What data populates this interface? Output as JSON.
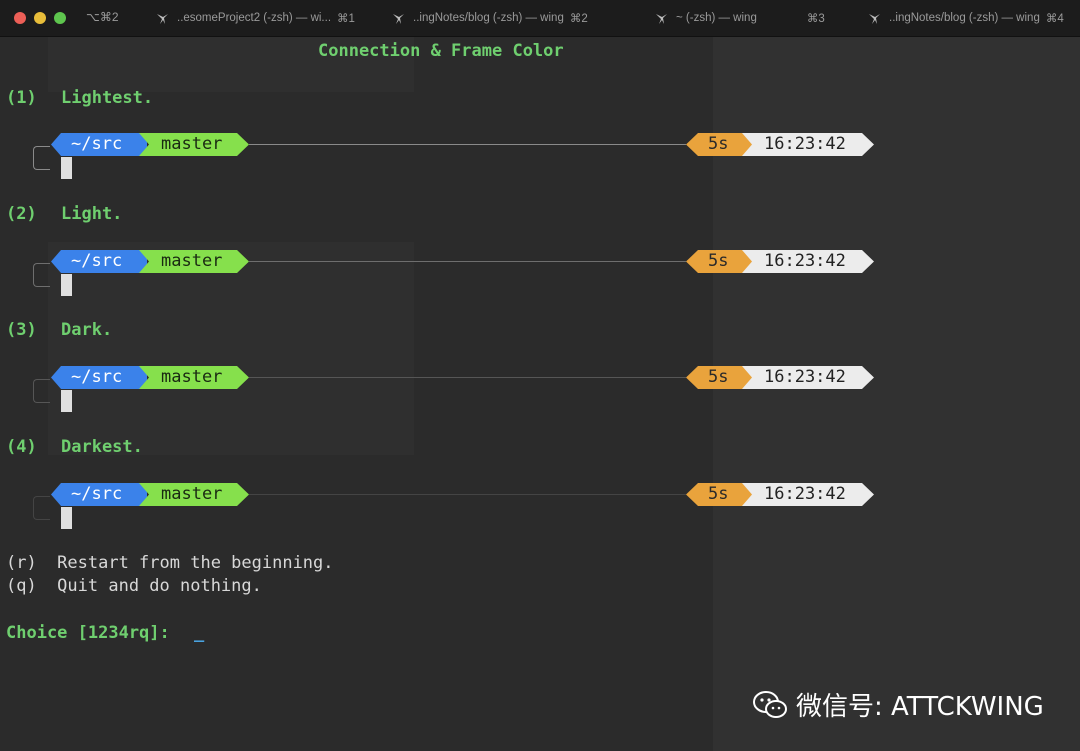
{
  "titlebar": {
    "first_shortcut": "⌥⌘2",
    "tabs": [
      {
        "label": "..esomeProject2 (-zsh) — wi...",
        "shortcut": "⌘1"
      },
      {
        "label": "..ingNotes/blog (-zsh) — wing",
        "shortcut": "⌘2"
      },
      {
        "label": "~ (-zsh) — wing",
        "shortcut": "⌘3"
      },
      {
        "label": "..ingNotes/blog (-zsh) — wing",
        "shortcut": "⌘4"
      }
    ],
    "traffic_colors": [
      "#ec5f57",
      "#e8bd3a",
      "#5ec54e"
    ]
  },
  "terminal": {
    "heading": "Connection & Frame Color",
    "options": [
      {
        "key": "(1)",
        "label": "Lightest.",
        "line_color": "#8a8a8a"
      },
      {
        "key": "(2)",
        "label": "Light.",
        "line_color": "#6e6e6e"
      },
      {
        "key": "(3)",
        "label": "Dark.",
        "line_color": "#565656"
      },
      {
        "key": "(4)",
        "label": "Darkest.",
        "line_color": "#444444"
      }
    ],
    "prompt": {
      "dir": "~/src",
      "branch": "master",
      "duration": "5s",
      "time": "16:23:42"
    },
    "restart_line": "(r)  Restart from the beginning.",
    "quit_line": "(q)  Quit and do nothing.",
    "choice_prompt": "Choice [1234rq]: ",
    "choice_value": "_"
  },
  "watermark": {
    "text": "微信号: ATTCKWING"
  },
  "colors": {
    "accent_green": "#6fcf6f",
    "dir_blue": "#3b82ea",
    "branch_green": "#86e04c",
    "duration_orange": "#e9a33c"
  }
}
